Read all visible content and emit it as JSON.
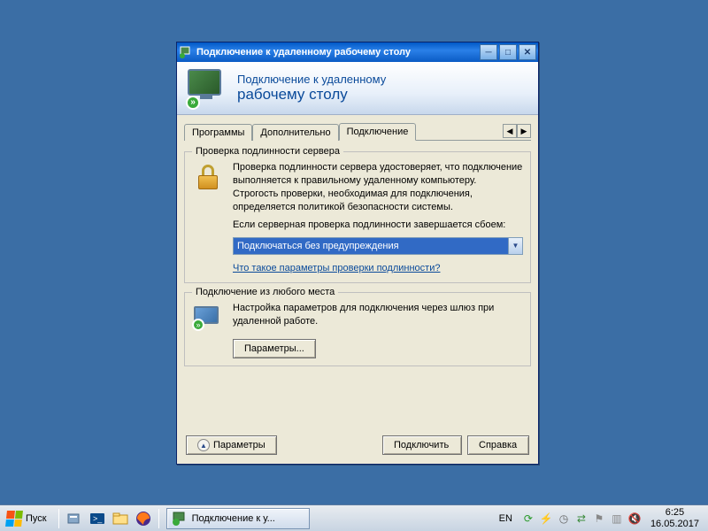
{
  "window": {
    "title": "Подключение к удаленному рабочему столу",
    "banner_line1": "Подключение к удаленному",
    "banner_line2": "рабочему столу"
  },
  "tabs": {
    "programs": "Программы",
    "advanced": "Дополнительно",
    "connection": "Подключение"
  },
  "auth_group": {
    "legend": "Проверка подлинности сервера",
    "para1": "Проверка подлинности сервера удостоверяет, что подключение выполняется к правильному удаленному компьютеру. Строгость проверки, необходимая для подключения, определяется политикой безопасности системы.",
    "para2": "Если серверная проверка подлинности завершается сбоем:",
    "combo_value": "Подключаться без предупреждения",
    "link": "Что такое параметры проверки подлинности?"
  },
  "anywhere_group": {
    "legend": "Подключение из любого места",
    "text": "Настройка параметров для подключения через шлюз при удаленной работе.",
    "button": "Параметры..."
  },
  "buttons": {
    "options": "Параметры",
    "connect": "Подключить",
    "help": "Справка"
  },
  "taskbar": {
    "start": "Пуск",
    "task_label": "Подключение к у...",
    "lang": "EN",
    "time": "6:25",
    "date": "16.05.2017"
  }
}
